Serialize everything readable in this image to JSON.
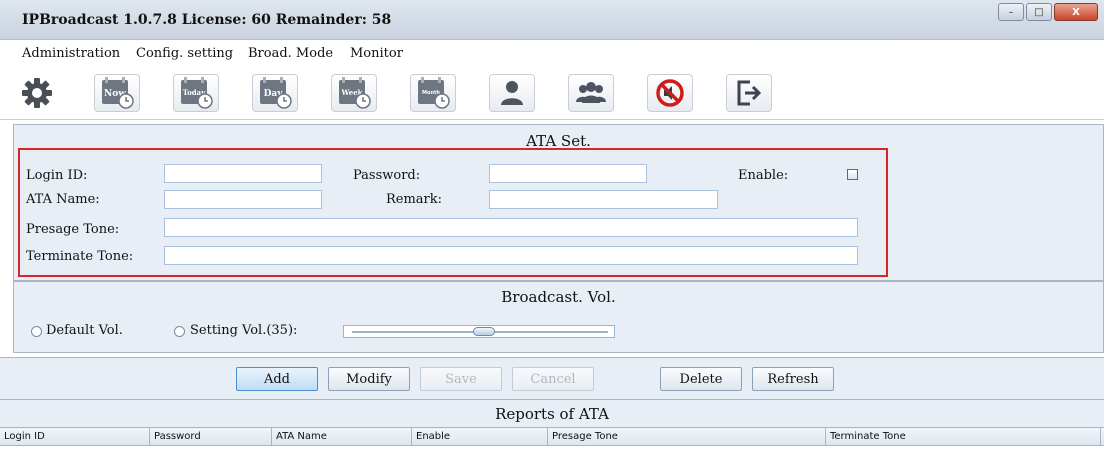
{
  "window": {
    "title": "IPBroadcast 1.0.7.8 License: 60 Remainder: 58",
    "controls": {
      "minimize": "–",
      "maximize": "□",
      "close": "X"
    }
  },
  "menu": [
    "Administration",
    "Config. setting",
    "Broad. Mode",
    "Monitor"
  ],
  "toolbar": {
    "icons": [
      "settings-gear-icon",
      "calendar-now-icon",
      "calendar-today-icon",
      "calendar-day-icon",
      "calendar-week-icon",
      "calendar-month-icon",
      "user-icon",
      "group-icon",
      "mute-icon",
      "exit-icon"
    ],
    "labels": {
      "now": "Now",
      "today": "Today",
      "day": "Day",
      "week": "Week",
      "month": "Month"
    }
  },
  "ata_set": {
    "title": "ATA Set.",
    "login_id": {
      "label": "Login ID:",
      "value": ""
    },
    "password": {
      "label": "Password:",
      "value": ""
    },
    "enable": {
      "label": "Enable:",
      "checked": false
    },
    "ata_name": {
      "label": "ATA Name:",
      "value": ""
    },
    "remark": {
      "label": "Remark:",
      "value": ""
    },
    "presage_tone": {
      "label": "Presage Tone:",
      "value": ""
    },
    "terminate_tone": {
      "label": "Terminate Tone:",
      "value": ""
    }
  },
  "broadcast_vol": {
    "title": "Broadcast. Vol.",
    "default_vol": "Default Vol.",
    "setting_vol": "Setting Vol.(35):",
    "level": 35
  },
  "buttons": {
    "add": "Add",
    "modify": "Modify",
    "save": "Save",
    "cancel": "Cancel",
    "delete": "Delete",
    "refresh": "Refresh"
  },
  "reports": {
    "title": "Reports of ATA",
    "columns": [
      "Login ID",
      "Password",
      "ATA Name",
      "Enable",
      "Presage Tone",
      "Terminate Tone"
    ]
  },
  "colors": {
    "highlight_border": "#d6262a",
    "panel_bg": "#e8eef6"
  }
}
